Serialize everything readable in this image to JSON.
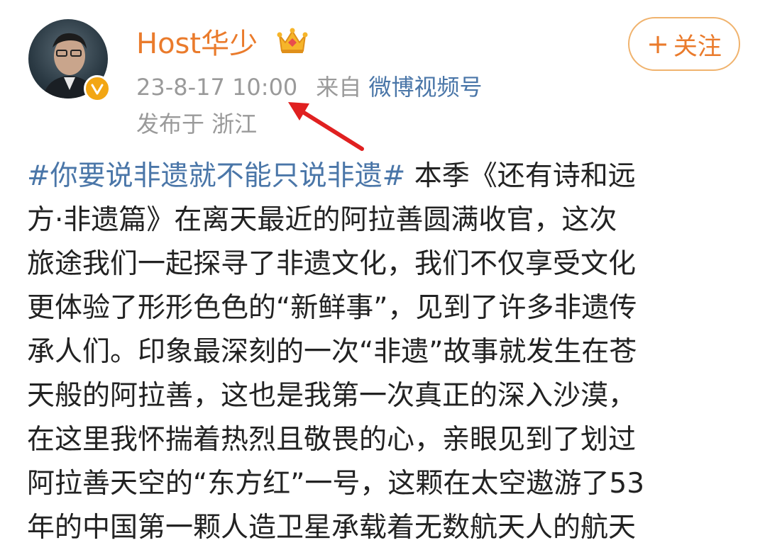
{
  "user": {
    "name": "Host华少",
    "crown_icon": "crown-icon",
    "verified_icon": "verified-badge-icon",
    "verified_color": "#f2a614",
    "name_color": "#ea7b2c"
  },
  "follow_button": {
    "plus": "+",
    "label": "关注"
  },
  "meta": {
    "time": "23-8-17 10:00",
    "from_prefix": "来自",
    "source": "微博视频号",
    "location": "发布于 浙江"
  },
  "post": {
    "hashtag": "#你要说非遗就不能只说非遗#",
    "line1_rest": " 本季《还有诗和远",
    "lines": [
      "方·非遗篇》在离天最近的阿拉善圆满收官，这次",
      "旅途我们一起探寻了非遗文化，我们不仅享受文化",
      "更体验了形形色色的“新鲜事”，见到了许多非遗传",
      "承人们。印象最深刻的一次“非遗”故事就发生在苍",
      "天般的阿拉善，这也是我第一次真正的深入沙漠，",
      "在这里我怀揣着热烈且敬畏的心，亲眼见到了划过",
      "阿拉善天空的“东方红”一号，这颗在太空遨游了53",
      "年的中国第一颗人造卫星承载着无数航天人的航天"
    ]
  },
  "annotation": {
    "arrow_color": "#e02020"
  }
}
